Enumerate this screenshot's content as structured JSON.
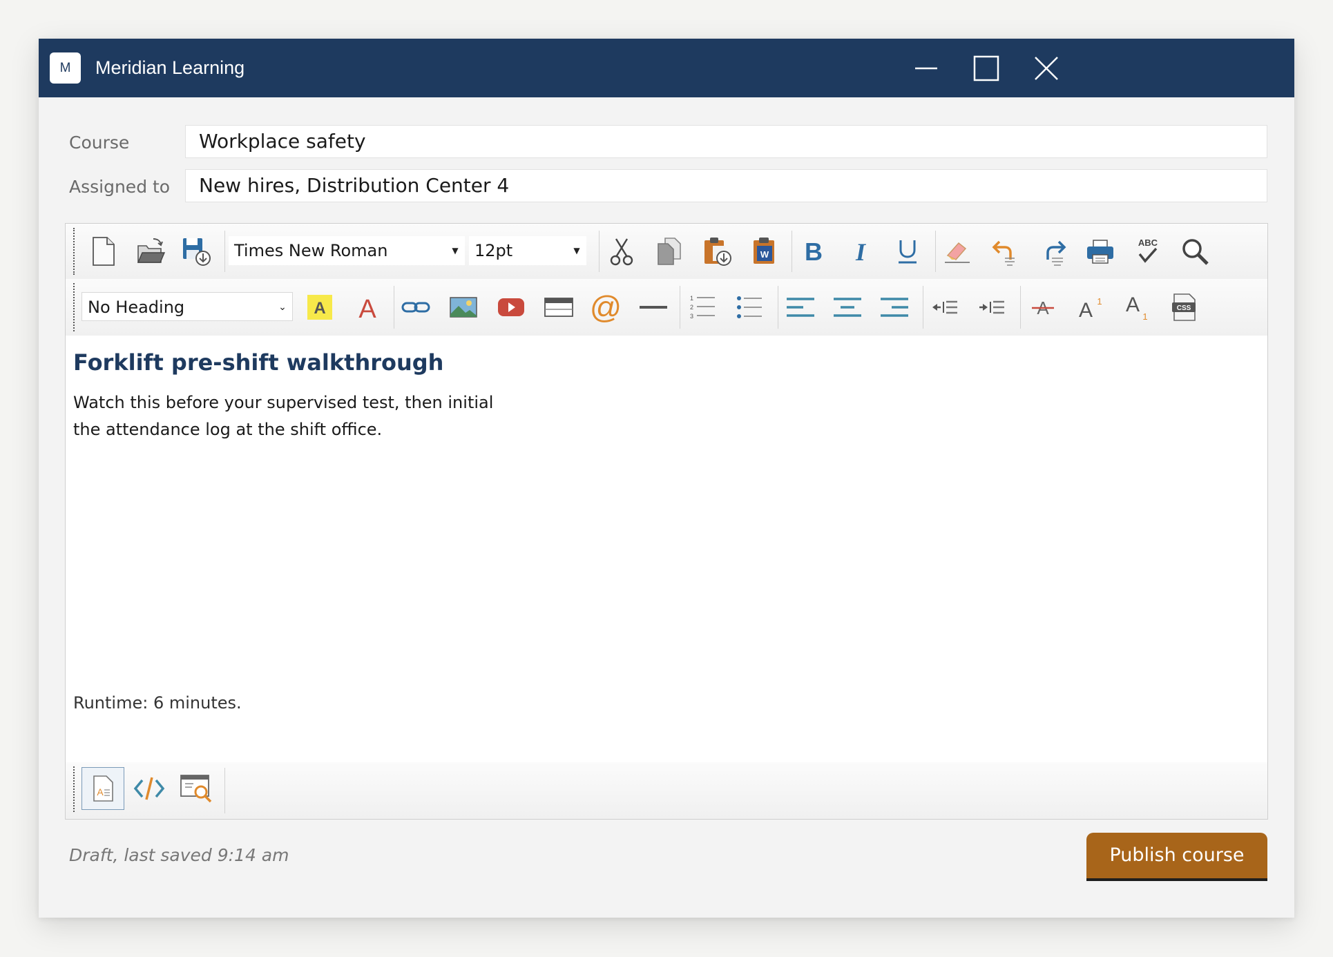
{
  "window": {
    "logo_letter": "M",
    "title": "Meridian Learning",
    "minimize_icon": "minimize-icon",
    "maximize_icon": "maximize-icon",
    "close_icon": "close-icon"
  },
  "form": {
    "course_label": "Course",
    "course_value": "Workplace safety",
    "assigned_label": "Assigned to",
    "assigned_value": "New hires, Distribution Center 4"
  },
  "toolbar1": {
    "font_family": "Times New Roman",
    "font_size": "12pt",
    "icons": [
      "new-document-icon",
      "open-folder-icon",
      "save-icon",
      "cut-icon",
      "copy-icon",
      "paste-icon",
      "paste-from-word-icon",
      "bold-icon",
      "italic-icon",
      "underline-icon",
      "eraser-icon",
      "undo-icon",
      "redo-icon",
      "print-icon",
      "spellcheck-icon",
      "find-icon"
    ]
  },
  "toolbar2": {
    "heading": "No Heading",
    "icons": [
      "highlight-color-icon",
      "font-color-icon",
      "link-icon",
      "image-icon",
      "video-icon",
      "table-icon",
      "email-icon",
      "horizontal-rule-icon",
      "numbered-list-icon",
      "bulleted-list-icon",
      "align-left-icon",
      "align-center-icon",
      "align-right-icon",
      "outdent-icon",
      "indent-icon",
      "strikethrough-icon",
      "superscript-icon",
      "subscript-icon",
      "css-icon"
    ]
  },
  "content": {
    "heading": "Forklift pre-shift walkthrough",
    "paragraph": "Watch this before your supervised test, then initial the attendance log at the shift office.",
    "runtime": "Runtime: 6 minutes."
  },
  "view_modes": [
    "design-view-icon",
    "code-view-icon",
    "preview-icon"
  ],
  "footer": {
    "status": "Draft, last saved 9:14 am",
    "publish_label": "Publish course"
  },
  "colors": {
    "titlebar": "#1e3a5f",
    "heading": "#1e3a5f",
    "accent": "#a8651a",
    "icon_blue": "#2e6da4",
    "icon_teal": "#3f8aa8",
    "icon_red": "#c94a3d",
    "icon_orange": "#e08a2c"
  }
}
